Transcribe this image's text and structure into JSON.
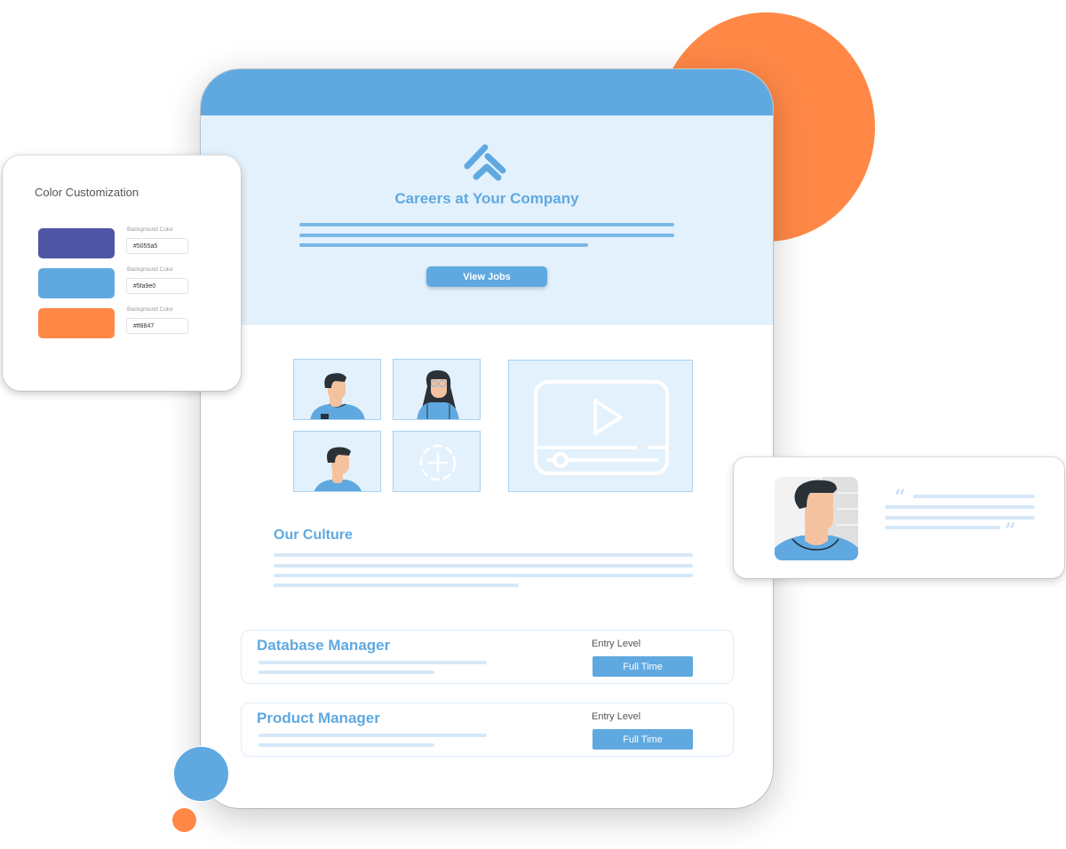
{
  "colors": {
    "accent_blue": "#5fa9e0",
    "accent_orange": "#ff8847",
    "accent_purple": "#5055a5",
    "hero_bg": "#e3f1fc"
  },
  "hero": {
    "title": "Careers at Your Company",
    "cta_label": "View Jobs"
  },
  "culture": {
    "title": "Our Culture"
  },
  "jobs": [
    {
      "title": "Database Manager",
      "level": "Entry Level",
      "type": "Full Time"
    },
    {
      "title": "Product Manager",
      "level": "Entry Level",
      "type": "Full Time"
    }
  ],
  "color_panel": {
    "title": "Color Customization",
    "items": [
      {
        "label": "Background Color",
        "value": "#5055a5",
        "color": "#5055a5"
      },
      {
        "label": "Background Color",
        "value": "#5fa9e0",
        "color": "#5fa9e0"
      },
      {
        "label": "Background Color",
        "value": "#ff8847",
        "color": "#ff8847"
      }
    ]
  },
  "testimonial": {
    "open_quote": "“",
    "close_quote": "”"
  }
}
